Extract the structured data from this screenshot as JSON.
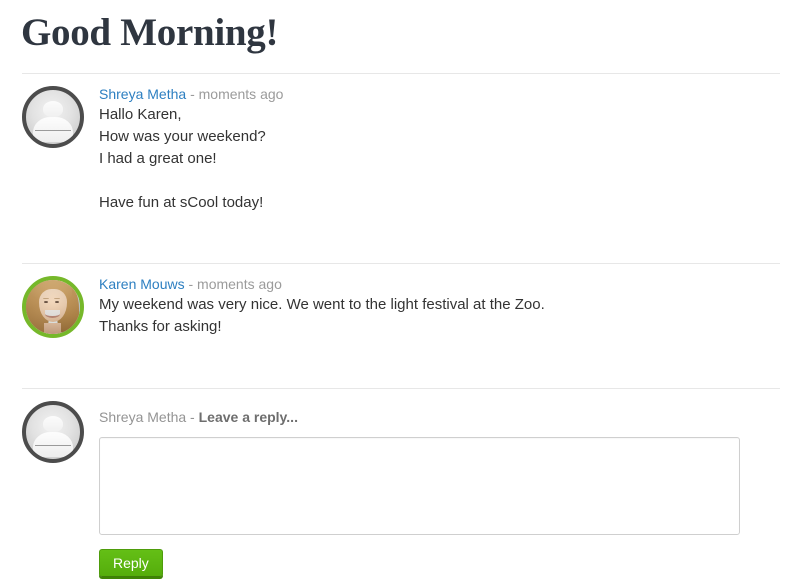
{
  "page": {
    "title": "Good Morning!"
  },
  "comments": [
    {
      "author": "Shreya Metha",
      "time": "- moments ago",
      "avatar_type": "default-silhouette-avatar",
      "lines": [
        "Hallo Karen,",
        "How was your weekend?",
        "I had a great one!",
        "",
        "Have fun at sCool today!"
      ]
    },
    {
      "author": "Karen Mouws",
      "time": "- moments ago",
      "avatar_type": "photo-avatar",
      "lines": [
        "My weekend was very nice. We went to the light festival at the Zoo.",
        "Thanks for asking!"
      ]
    }
  ],
  "reply_form": {
    "avatar_type": "default-silhouette-avatar",
    "author": "Shreya Metha - ",
    "prompt": "Leave a reply...",
    "textarea_value": "",
    "textarea_placeholder": "",
    "submit_label": "Reply",
    "accent_color": "#5cb811"
  }
}
